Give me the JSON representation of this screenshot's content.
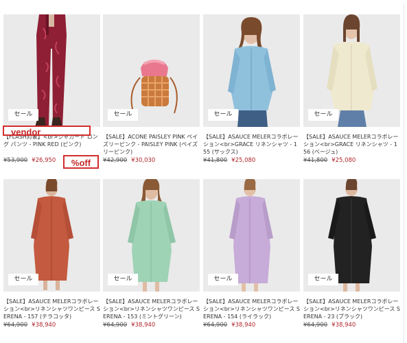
{
  "products": [
    {
      "sale_tag": "セール",
      "title": "【FLASH対象】<br>ジャカード ロング パンツ - PINK RED (ピンク)",
      "original_price": "¥53,900",
      "sale_price": "¥26,950",
      "image": "model-pink-jacquard-pants"
    },
    {
      "sale_tag": "セール",
      "title": "【SALE】ACONE PAISLEY PINK ペイズリーピンク - PAISLEY PINK (ペイズリーピンク)",
      "original_price": "¥42,900",
      "sale_price": "¥30,030",
      "image": "bucket-bag-paisley-pink"
    },
    {
      "sale_tag": "セール",
      "title": "【SALE】ASAUCE MELERコラボレーション<br>GRACE リネンシャツ - 155 (サックス)",
      "original_price": "¥41,800",
      "sale_price": "¥25,080",
      "image": "model-blue-linen-shirt"
    },
    {
      "sale_tag": "セール",
      "title": "【SALE】ASAUCE MELERコラボレーション<br>GRACE リネンシャツ - 156 (ベージュ)",
      "original_price": "¥41,800",
      "sale_price": "¥25,080",
      "image": "model-beige-linen-shirt"
    },
    {
      "sale_tag": "セール",
      "title": "【SALE】ASAUCE MELERコラボレーション<br>リネンシャツワンピース SERENA - 157 (テラコッタ)",
      "original_price": "¥64,900",
      "sale_price": "¥38,940",
      "image": "model-terracotta-shirt-dress"
    },
    {
      "sale_tag": "セール",
      "title": "【SALE】ASAUCE MELERコラボレーション<br>リネンシャツワンピース SERENA - 153 (ミントグリーン)",
      "original_price": "¥64,900",
      "sale_price": "¥38,940",
      "image": "model-mint-shirt-dress"
    },
    {
      "sale_tag": "セール",
      "title": "【SALE】ASAUCE MELERコラボレーション<br>リネンシャツワンピース SERENA - 154 (ライラック)",
      "original_price": "¥64,900",
      "sale_price": "¥38,940",
      "image": "model-lilac-shirt-dress"
    },
    {
      "sale_tag": "セール",
      "title": "【SALE】ASAUCE MELERコラボレーション<br>リネンシャツワンピース SERENA - 23 (ブラック)",
      "original_price": "¥64,900",
      "sale_price": "¥38,940",
      "image": "model-black-shirt-dress"
    }
  ],
  "annotations": {
    "vendor": "vendor",
    "percent_off": "%off"
  },
  "colors": {
    "sale_price": "#b0262c",
    "annotation": "#d22d2d",
    "photo_background": "#ebebeb"
  }
}
